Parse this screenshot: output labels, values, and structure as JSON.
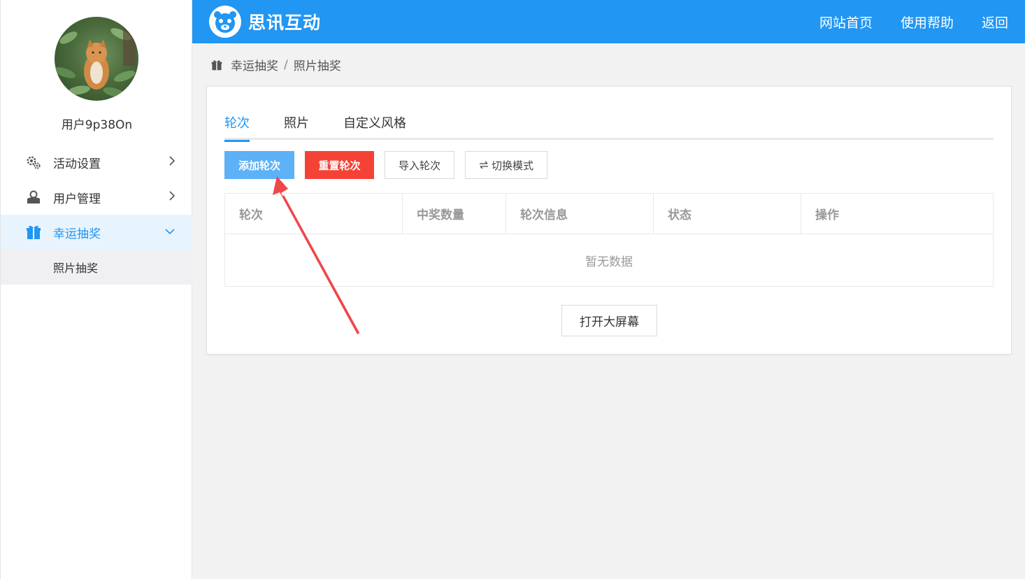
{
  "sidebar": {
    "username": "用户9p38On",
    "menu": [
      {
        "label": "活动设置",
        "icon": "gear-icon"
      },
      {
        "label": "用户管理",
        "icon": "user-icon"
      },
      {
        "label": "幸运抽奖",
        "icon": "gift-icon"
      }
    ],
    "submenu": [
      {
        "label": "照片抽奖"
      }
    ]
  },
  "header": {
    "brand": "思讯互动",
    "nav": [
      "网站首页",
      "使用帮助",
      "返回"
    ]
  },
  "breadcrumb": [
    "幸运抽奖",
    "照片抽奖"
  ],
  "breadcrumb_sep": "/",
  "tabs": [
    "轮次",
    "照片",
    "自定义风格"
  ],
  "buttons": {
    "add": "添加轮次",
    "reset": "重置轮次",
    "import": "导入轮次",
    "switch": "切换模式"
  },
  "table": {
    "columns": [
      "轮次",
      "中奖数量",
      "轮次信息",
      "状态",
      "操作"
    ],
    "empty_text": "暂无数据"
  },
  "open_screen": "打开大屏幕",
  "colors": {
    "primary": "#2196f3",
    "danger": "#f44336",
    "active_bg": "#e8f4fd",
    "annotation_arrow": "#f0474b"
  }
}
